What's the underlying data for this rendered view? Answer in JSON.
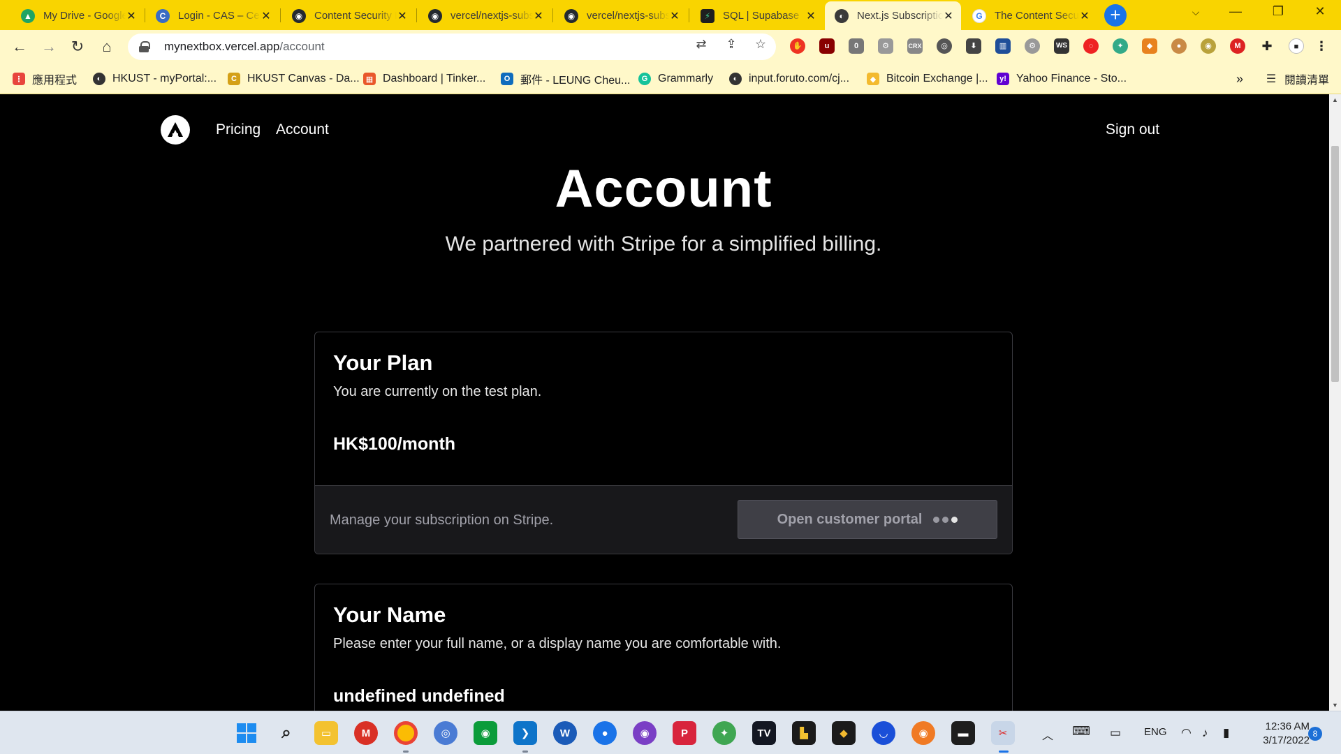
{
  "browser": {
    "tabs": [
      {
        "title": "My Drive - Google Drive",
        "icon": "google-drive-icon",
        "color": "#1fa463"
      },
      {
        "title": "Login - CAS – Central Authentication Service",
        "icon": "cas-icon",
        "color": "#3a6cc4"
      },
      {
        "title": "Content Security Policy",
        "icon": "github-icon",
        "color": "#24292f"
      },
      {
        "title": "vercel/nextjs-subscription-payments",
        "icon": "github-icon",
        "color": "#24292f"
      },
      {
        "title": "vercel/nextjs-subscription-payments",
        "icon": "github-icon",
        "color": "#24292f"
      },
      {
        "title": "SQL | Supabase",
        "icon": "supabase-icon",
        "color": "#1f1f1f"
      },
      {
        "title": "Next.js Subscription Starter",
        "icon": "website-icon",
        "color": "#3a3a3a",
        "active": true
      },
      {
        "title": "The Content Security Policy",
        "icon": "google-icon",
        "color": "#4285f4"
      }
    ],
    "new_tab_label": "+",
    "address": {
      "host": "mynextbox.vercel.app",
      "path": "/account"
    },
    "bookmarks": [
      {
        "label": "應用程式",
        "icon": "apps-grid-icon",
        "color": "#e8453c"
      },
      {
        "label": "HKUST - myPortal:...",
        "icon": "website-icon",
        "color": "#333333"
      },
      {
        "label": "HKUST Canvas - Da...",
        "icon": "canvas-icon",
        "color": "#d4a017"
      },
      {
        "label": "Dashboard | Tinker...",
        "icon": "tinkercad-icon",
        "color": "#e9582b"
      },
      {
        "label": "郵件 - LEUNG Cheu...",
        "icon": "outlook-icon",
        "color": "#0f6cbd"
      },
      {
        "label": "Grammarly",
        "icon": "grammarly-icon",
        "color": "#15c39a"
      },
      {
        "label": "input.foruto.com/cj...",
        "icon": "website-icon",
        "color": "#333333"
      },
      {
        "label": "Bitcoin Exchange |...",
        "icon": "bitcoin-icon",
        "color": "#f3ba2f"
      },
      {
        "label": "Yahoo Finance - Sto...",
        "icon": "yahoo-icon",
        "color": "#6001d2"
      }
    ],
    "bookmarks_overflow": "»",
    "reading_list": "閱讀清單",
    "extension_badge": "0"
  },
  "nav": {
    "links": [
      "Pricing",
      "Account"
    ],
    "signout": "Sign out"
  },
  "hero": {
    "title": "Account",
    "subtitle": "We partnered with Stripe for a simplified billing."
  },
  "plan_card": {
    "title": "Your Plan",
    "description": "You are currently on the test plan.",
    "value": "HK$100/month",
    "footer_text": "Manage your subscription on Stripe.",
    "button_label": "Open customer portal"
  },
  "name_card": {
    "title": "Your Name",
    "description": "Please enter your full name, or a display name you are comfortable with.",
    "value": "undefined undefined"
  },
  "taskbar": {
    "language": "ENG",
    "time": "12:36 AM",
    "date": "3/17/2022",
    "notifications": "8"
  },
  "colors": {
    "chrome_yellow": "#f9d400",
    "page_bg": "#000000",
    "card_border": "#3a3a3f",
    "card_footer": "#18181b"
  }
}
